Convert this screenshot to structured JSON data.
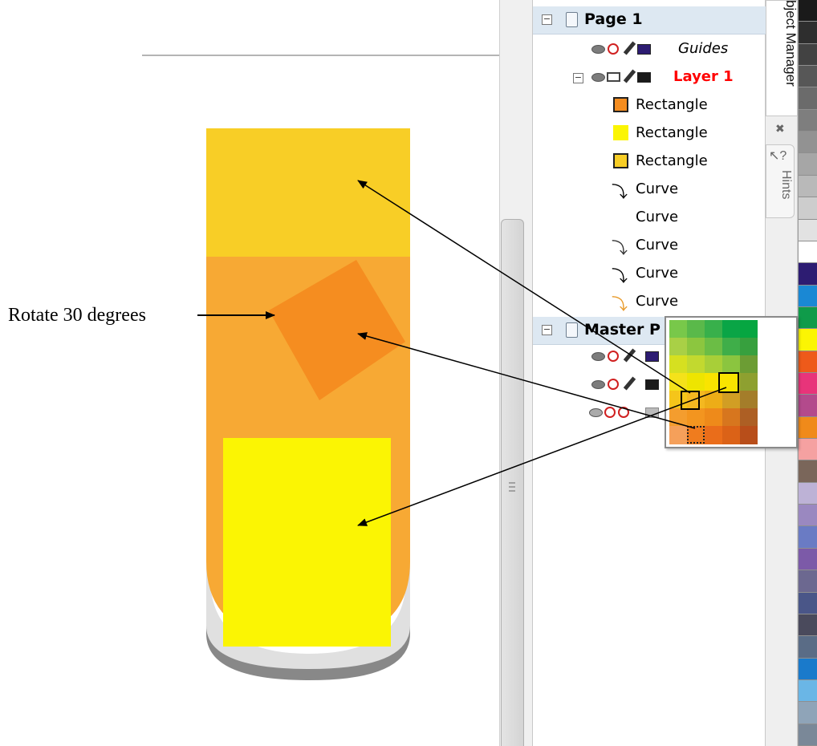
{
  "caption": "Rotate 30 degrees",
  "canvas_shapes": [
    {
      "name": "top-rectangle",
      "color": "#f8ce26"
    },
    {
      "name": "body-rectangle",
      "color": "#f7a934"
    },
    {
      "name": "rotated-rectangle",
      "color": "#f58d20"
    },
    {
      "name": "yellow-rectangle",
      "color": "#fbf503"
    }
  ],
  "object_manager": {
    "tab_label": "Object Manager",
    "visible_tab_label": "bject Manager",
    "hints_label": "Hints",
    "page": {
      "label": "Page 1",
      "guides": {
        "label": "Guides",
        "color": "#2d1c72"
      },
      "layer": {
        "label": "Layer 1",
        "color": "#1a1a1a",
        "label_color": "#ff0000"
      },
      "objects": [
        {
          "label": "Rectangle",
          "icon": "rectangle-icon",
          "fill": "#f58d20"
        },
        {
          "label": "Rectangle",
          "icon": "rectangle-icon",
          "fill": "#fbf503"
        },
        {
          "label": "Rectangle",
          "icon": "rectangle-icon",
          "fill": "#f8ce26"
        },
        {
          "label": "Curve",
          "icon": "curve-icon",
          "fill": "#ffffff"
        },
        {
          "label": "Curve",
          "icon": "none",
          "fill": ""
        },
        {
          "label": "Curve",
          "icon": "curve-icon",
          "fill": "#555555"
        },
        {
          "label": "Curve",
          "icon": "curve-icon",
          "fill": "#ffffff"
        },
        {
          "label": "Curve",
          "icon": "curve-icon",
          "fill": "#f7a934"
        }
      ]
    },
    "master": {
      "label": "Master P",
      "rows": [
        {
          "icon": "guides-row",
          "color": "#2d1c72"
        },
        {
          "icon": "desktop-row",
          "color": "#1a1a1a"
        },
        {
          "icon": "grid-row",
          "color": "#bbbbbb"
        }
      ]
    }
  },
  "fill_picker": {
    "rows": [
      [
        "#78c84a",
        "#5ab94a",
        "#38b04b",
        "#0aa546",
        "#06a641"
      ],
      [
        "#a9d046",
        "#8cc63f",
        "#6bbd45",
        "#3fae49",
        "#37a03e"
      ],
      [
        "#d6e020",
        "#c2d92f",
        "#a8cf38",
        "#8bc53f",
        "#6c9d34"
      ],
      [
        "#f4e21a",
        "#eee500",
        "#f9e400",
        "#c4b81e",
        "#8ea030"
      ],
      [
        "#f5c51a",
        "#f4b820",
        "#edad17",
        "#d19e24",
        "#a47d2a"
      ],
      [
        "#f49d2e",
        "#f3951f",
        "#ee8a1a",
        "#d7761e",
        "#ad5f24"
      ],
      [
        "#f5a05a",
        "#f07c1e",
        "#ea6d1a",
        "#db6217",
        "#b84e1a"
      ]
    ]
  },
  "palette": [
    "#1a1a1a",
    "#2e2e2e",
    "#424242",
    "#575757",
    "#6b6b6b",
    "#7e7e7e",
    "#929292",
    "#a6a6a6",
    "#b9b9b9",
    "#cdcdcd",
    "#e2e2e2",
    "#ffffff",
    "#2d1c72",
    "#1a88d4",
    "#0f9b4a",
    "#fbf503",
    "#ee5a1a",
    "#e8347a",
    "#b34a8c",
    "#f08a1a",
    "#f5a1a1",
    "#7a665a",
    "#bdb2d6",
    "#9a88c0",
    "#6a7bc4",
    "#7c5aa8",
    "#6c6890",
    "#4a5688",
    "#4a4a5c",
    "#5a6c86",
    "#1a7acb",
    "#6ab6e6",
    "#8fa4b8",
    "#7a8898"
  ]
}
